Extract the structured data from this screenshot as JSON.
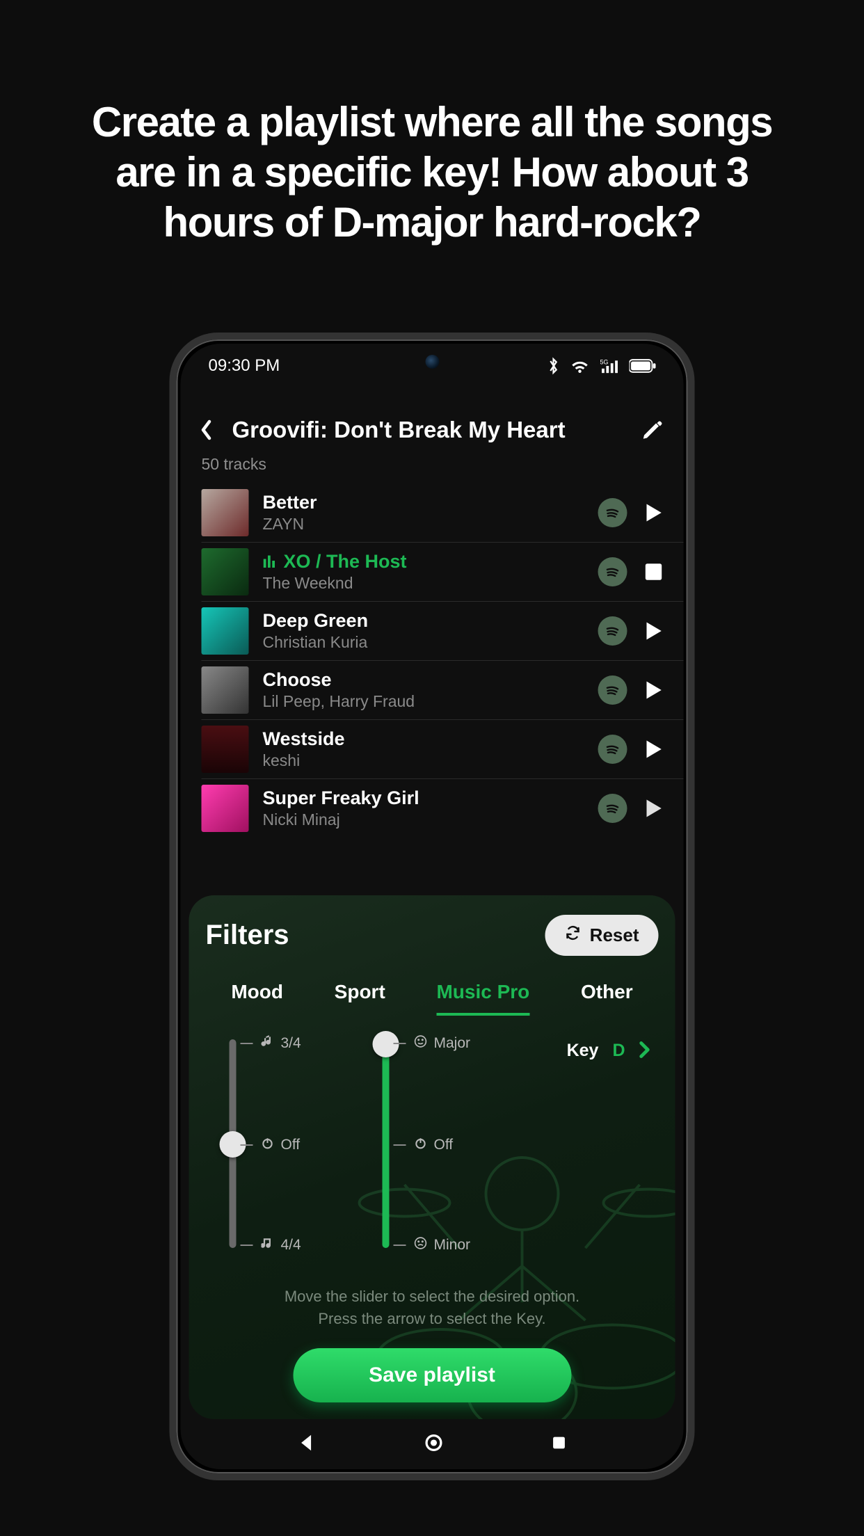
{
  "promo": {
    "heading": "Create a playlist where all the songs are in a specific key! How about 3 hours of D-major hard-rock?"
  },
  "status": {
    "time": "09:30 PM"
  },
  "header": {
    "title": "Groovifi: Don't Break My Heart"
  },
  "playlist": {
    "count_label": "50 tracks",
    "tracks": [
      {
        "title": "Better",
        "artist": "ZAYN",
        "playing": false
      },
      {
        "title": "XO / The Host",
        "artist": "The Weeknd",
        "playing": true
      },
      {
        "title": "Deep Green",
        "artist": "Christian Kuria",
        "playing": false
      },
      {
        "title": "Choose",
        "artist": "Lil Peep, Harry Fraud",
        "playing": false
      },
      {
        "title": "Westside",
        "artist": "keshi",
        "playing": false
      },
      {
        "title": "Super Freaky Girl",
        "artist": "Nicki Minaj",
        "playing": false
      }
    ]
  },
  "filters": {
    "title": "Filters",
    "reset_label": "Reset",
    "tabs": [
      "Mood",
      "Sport",
      "Music Pro",
      "Other"
    ],
    "active_tab": "Music Pro",
    "time_sig": {
      "top": "3/4",
      "mid": "Off",
      "bottom": "4/4",
      "value": "Off"
    },
    "mode": {
      "top": "Major",
      "mid": "Off",
      "bottom": "Minor",
      "value": "Major"
    },
    "key": {
      "label": "Key",
      "value": "D"
    },
    "hint_line1": "Move the slider to select the desired option.",
    "hint_line2": "Press the arrow to select the Key.",
    "save_label": "Save playlist"
  }
}
